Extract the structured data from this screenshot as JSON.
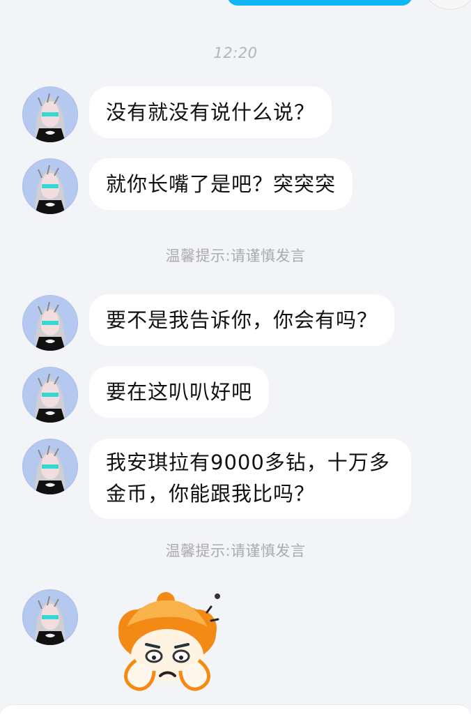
{
  "chat": {
    "timestamp": "12:20",
    "tip_1": "温馨提示:请谨慎发言",
    "tip_2": "温馨提示:请谨慎发言",
    "messages": [
      {
        "text": "没有就没有说什么说？"
      },
      {
        "text": "就你长嘴了是吧？突突突"
      },
      {
        "text": "要不是我告诉你，你会有吗？"
      },
      {
        "text": "要在这叭叭好吧"
      },
      {
        "text": "我安琪拉有9000多钻，十万多金币，你能跟我比吗？"
      }
    ],
    "sticker_icon": "orange-haired-girl-sticker",
    "avatar_icon": "anime-character-avatar"
  },
  "colors": {
    "background": "#f3f4f7",
    "incoming_bubble": "#ffffff",
    "outgoing_bubble": "#11b6f7",
    "system_text": "#a9abb0"
  }
}
